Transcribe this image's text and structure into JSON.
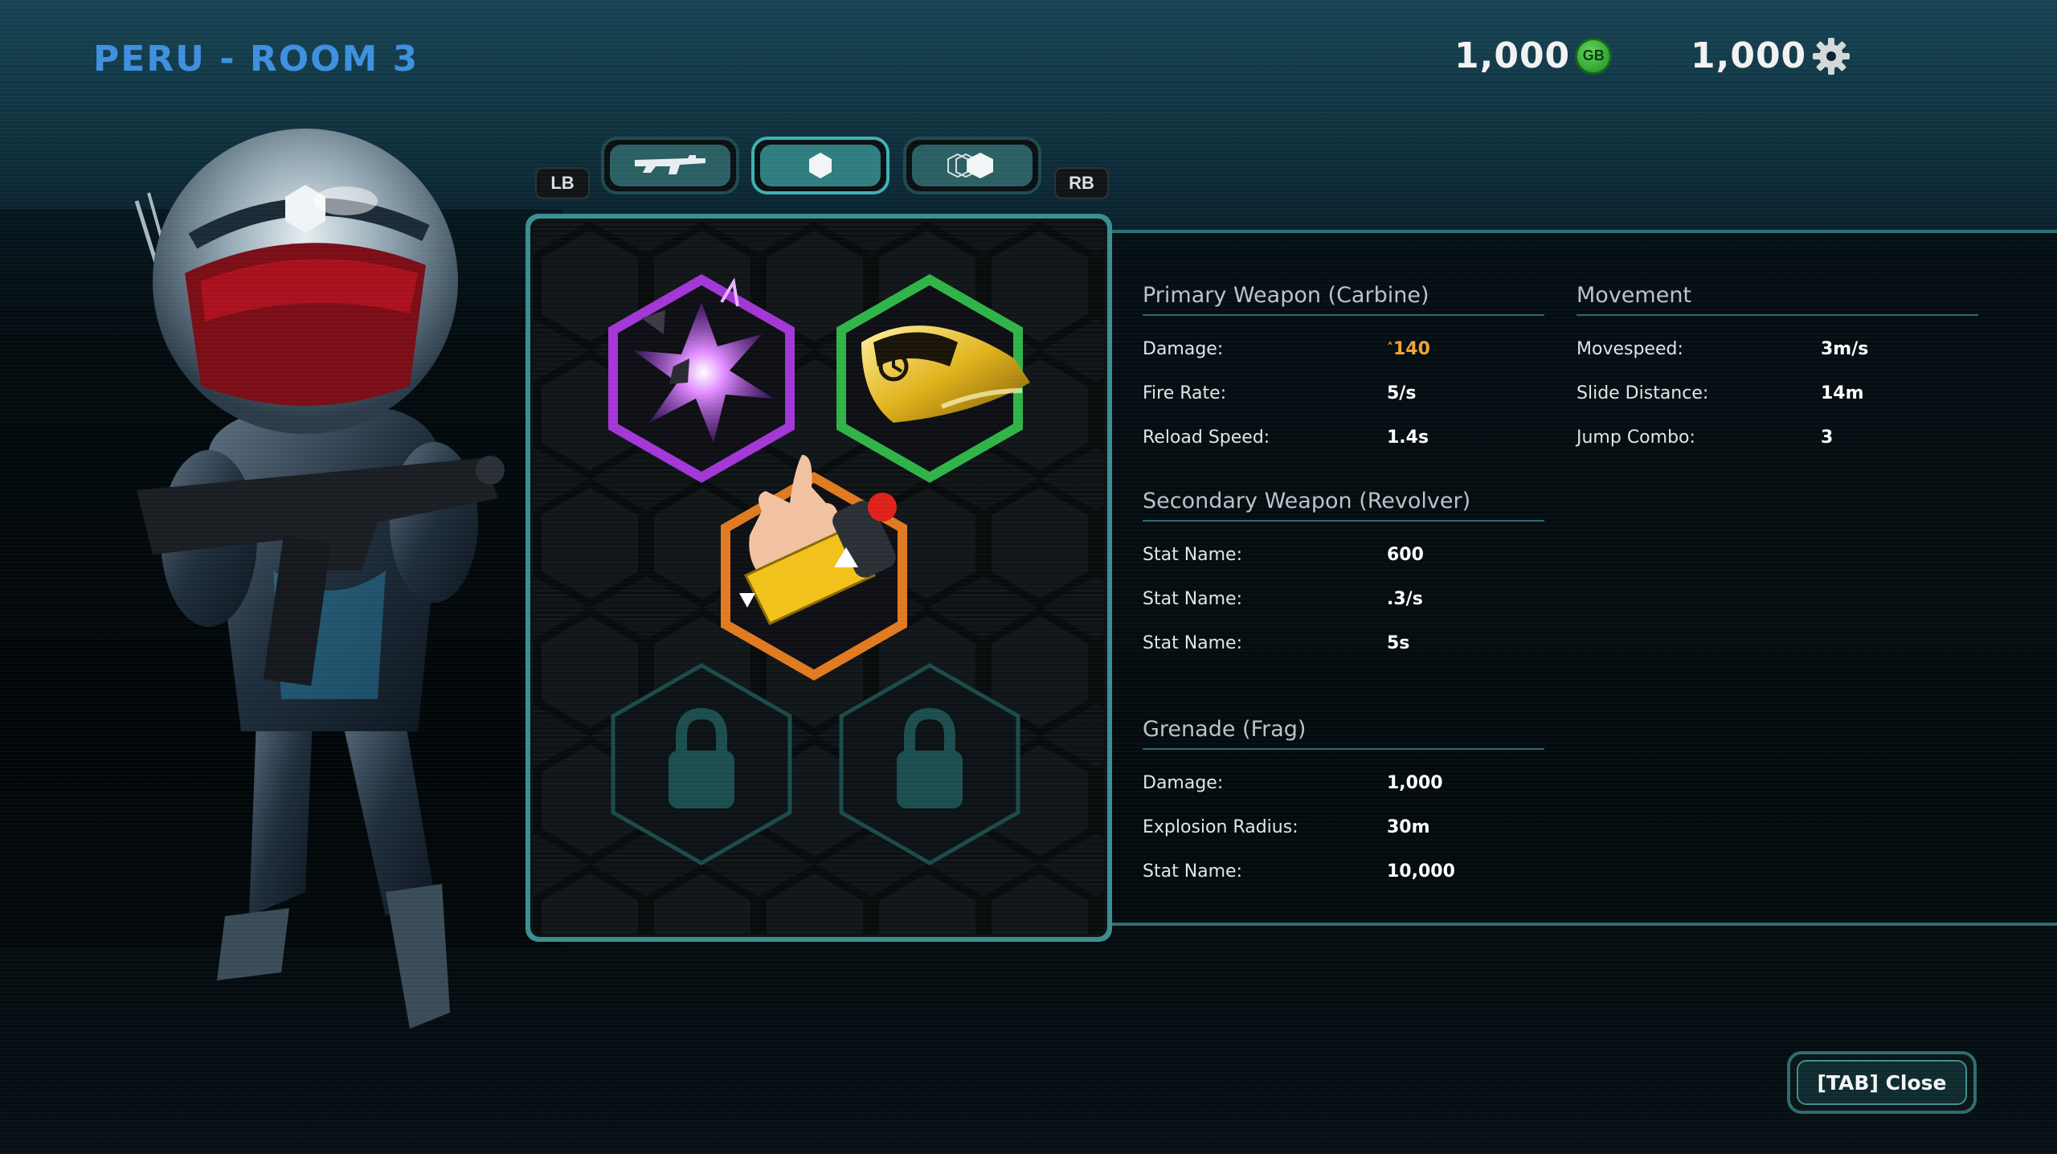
{
  "header": {
    "title": "PERU - ROOM 3",
    "currency_gb": {
      "value": "1,000",
      "badge": "GB",
      "icon": "gb-coin-icon"
    },
    "currency_gear": {
      "value": "1,000",
      "icon": "gear-icon"
    }
  },
  "tabs": {
    "left_shoulder": "LB",
    "right_shoulder": "RB",
    "items": [
      {
        "icon": "rifle-icon",
        "active": false
      },
      {
        "icon": "hexagon-icon",
        "active": true
      },
      {
        "icon": "hexagon-stack-icon",
        "active": false
      }
    ]
  },
  "loadout": {
    "slots": [
      {
        "icon": "purple-explosion-icon",
        "color": "#a336d6",
        "locked": false
      },
      {
        "icon": "gold-helmet-icon",
        "color": "#2fb347",
        "locked": false
      },
      {
        "icon": "detonator-hand-icon",
        "color": "#e07a1f",
        "locked": false
      },
      {
        "icon": "lock-icon",
        "color": "#1b4a4b",
        "locked": true
      },
      {
        "icon": "lock-icon",
        "color": "#1b4a4b",
        "locked": true
      }
    ]
  },
  "stats": {
    "primary": {
      "title": "Primary Weapon (Carbine)",
      "rows": [
        {
          "label": "Damage:",
          "value": "140",
          "highlight": true,
          "prefix_icon": "up-arrow-icon"
        },
        {
          "label": "Fire Rate:",
          "value": "5/s"
        },
        {
          "label": "Reload Speed:",
          "value": "1.4s"
        }
      ]
    },
    "secondary": {
      "title": "Secondary Weapon (Revolver)",
      "rows": [
        {
          "label": "Stat Name:",
          "value": "600"
        },
        {
          "label": "Stat Name:",
          "value": ".3/s"
        },
        {
          "label": "Stat Name:",
          "value": "5s"
        }
      ]
    },
    "grenade": {
      "title": "Grenade (Frag)",
      "rows": [
        {
          "label": "Damage:",
          "value": "1,000"
        },
        {
          "label": "Explosion Radius:",
          "value": "30m"
        },
        {
          "label": "Stat Name:",
          "value": "10,000"
        }
      ]
    },
    "movement": {
      "title": "Movement",
      "rows": [
        {
          "label": "Movespeed:",
          "value": "3m/s"
        },
        {
          "label": "Slide Distance:",
          "value": "14m"
        },
        {
          "label": "Jump Combo:",
          "value": "3"
        }
      ]
    }
  },
  "footer": {
    "close_label": "[TAB] Close"
  },
  "colors": {
    "accent": "#3d8fe0",
    "panel_border": "#3a8e8f",
    "highlight": "#f0a33b"
  }
}
